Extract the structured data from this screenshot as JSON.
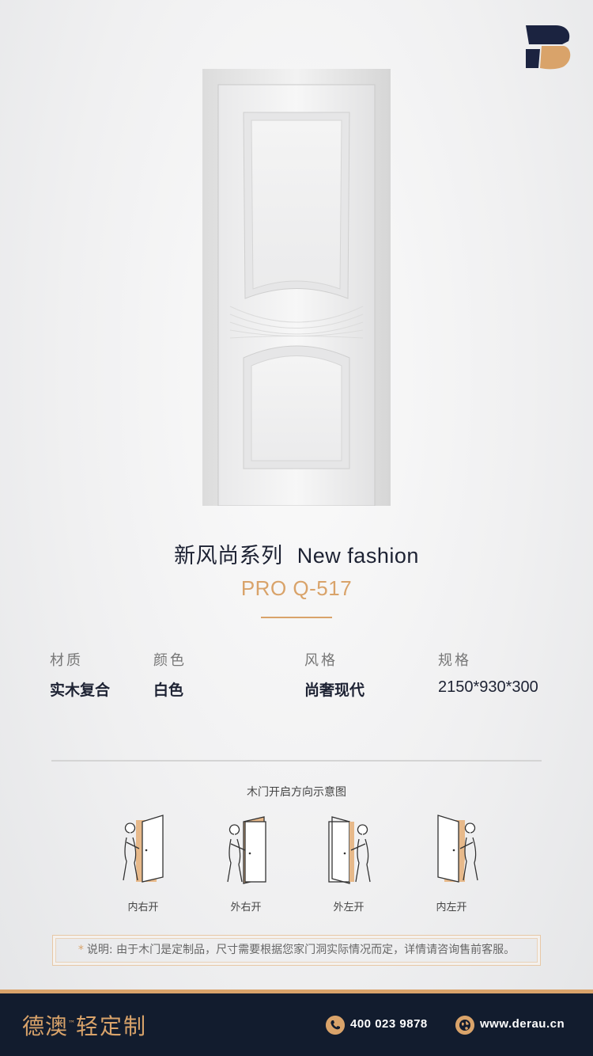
{
  "logo": {
    "name": "brand-logo",
    "colors": {
      "navy": "#1b2340",
      "gold": "#d9a36a"
    }
  },
  "product": {
    "series_cn": "新风尚系列",
    "series_en": "New fashion",
    "model": "PRO Q-517"
  },
  "specs": [
    {
      "label": "材质",
      "value": "实木复合"
    },
    {
      "label": "颜色",
      "value": "白色"
    },
    {
      "label": "风格",
      "value": "尚奢现代"
    },
    {
      "label": "规格",
      "value": "2150*930*300"
    }
  ],
  "diagram": {
    "title": "木门开启方向示意图",
    "items": [
      "内右开",
      "外右开",
      "外左开",
      "内左开"
    ]
  },
  "note": {
    "star": "*",
    "text": "说明: 由于木门是定制品，尺寸需要根据您家门洞实际情况而定，详情请咨询售前客服。"
  },
  "footer": {
    "brand": "德澳",
    "trademark": "™",
    "brand_sub": "轻定制",
    "phone": "400 023 9878",
    "website": "www.derau.cn",
    "icons": [
      "phone-icon",
      "globe-icon"
    ]
  },
  "colors": {
    "accent": "#d9a36a",
    "footer_bg": "#121c2e",
    "text_dark": "#1d2233"
  }
}
